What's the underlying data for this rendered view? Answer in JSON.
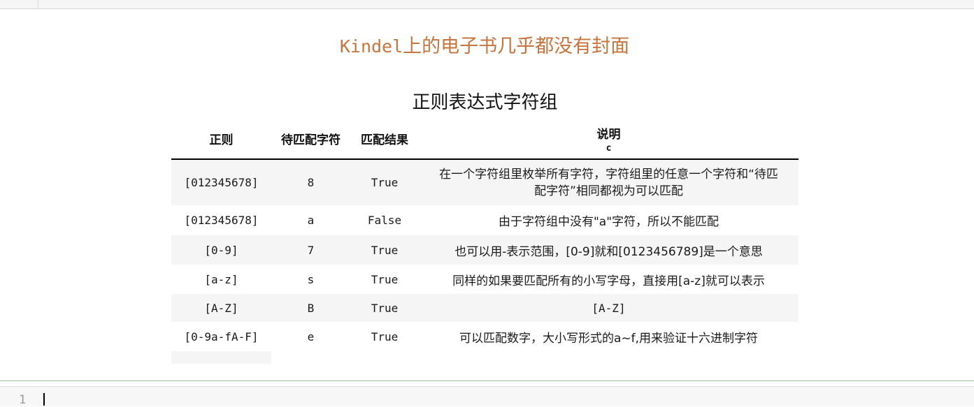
{
  "title_prefix": "Kindel",
  "title_suffix": "上的电子书几乎都没有封面",
  "table": {
    "caption": "正则表达式字符组",
    "headers": {
      "regex": "正则",
      "target": "待匹配字符",
      "result": "匹配结果",
      "desc": "说明",
      "desc_sub": "c"
    },
    "rows": [
      {
        "regex": "[012345678]",
        "target": "8",
        "result": "True",
        "desc": "在一个字符组里枚举所有字符，字符组里的任意一个字符和“待匹配字符”相同都视为可以匹配"
      },
      {
        "regex": "[012345678]",
        "target": "a",
        "result": "False",
        "desc": "由于字符组中没有\"a\"字符，所以不能匹配"
      },
      {
        "regex": "[0-9]",
        "target": "7",
        "result": "True",
        "desc": "也可以用-表示范围，[0-9]就和[0123456789]是一个意思"
      },
      {
        "regex": "[a-z]",
        "target": "s",
        "result": "True",
        "desc": "同样的如果要匹配所有的小写字母，直接用[a-z]就可以表示"
      },
      {
        "regex": "[A-Z]",
        "target": "B",
        "result": "True",
        "desc": "[A-Z]"
      },
      {
        "regex": "[0-9a-fA-F]",
        "target": "e",
        "result": "True",
        "desc": "可以匹配数字，大小写形式的a~f,用来验证十六进制字符"
      }
    ]
  },
  "editor": {
    "line_number": "1"
  }
}
